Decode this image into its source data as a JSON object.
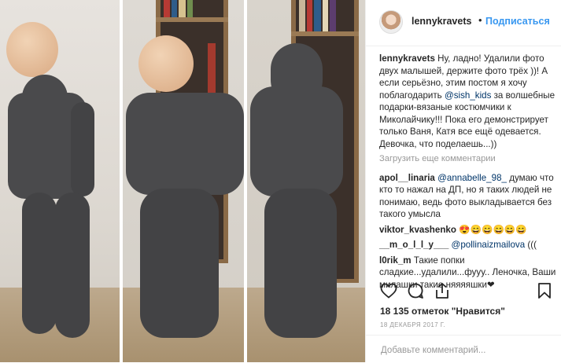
{
  "header": {
    "username": "lennykravets",
    "separator": "•",
    "follow_label": "Подписаться"
  },
  "caption": {
    "username": "lennykravets",
    "text_before": " Ну, ладно! Удалили фото двух малышей, держите фото трёх ))! А если серьёзно, этим постом я хочу поблагодарить ",
    "mention": "@sish_kids",
    "text_after": " за волшебные подарки-вязаные костюмчики к Миколайчику!!! Пока его демонстрирует только Ваня, Катя все ещё одевается. Девочка, что поделаешь...))"
  },
  "load_more_label": "Загрузить еще комментарии",
  "comments": [
    {
      "user": "apol__linaria",
      "mention": "@annabelle_98_",
      "text": " думаю что кто то нажал на ДП, но я таких людей не понимаю, ведь фото выкладывается без такого умысла"
    },
    {
      "user": "viktor_kvashenko",
      "mention": "",
      "text": " 😍😄😄😄😄😄"
    },
    {
      "user": "__m_o_l_l_y___",
      "mention": "@pollinaizmailova",
      "text": " ((("
    },
    {
      "user": "l0rik_m",
      "mention": "",
      "text": " Такие попки сладкие...удалили...фууу.. Леночка, Ваши милашки такие няяяяшки❤"
    }
  ],
  "actions": {
    "like_icon": "heart-icon",
    "comment_icon": "comment-bubble-icon",
    "share_icon": "share-icon",
    "save_icon": "bookmark-icon"
  },
  "likes_text": "18 135 отметок \"Нравится\"",
  "date_text": "18 декабря 2017 г.",
  "add_comment_placeholder": "Добавьте комментарий...",
  "colors": {
    "link": "#3897f0",
    "mention": "#003569",
    "muted": "#999999"
  }
}
